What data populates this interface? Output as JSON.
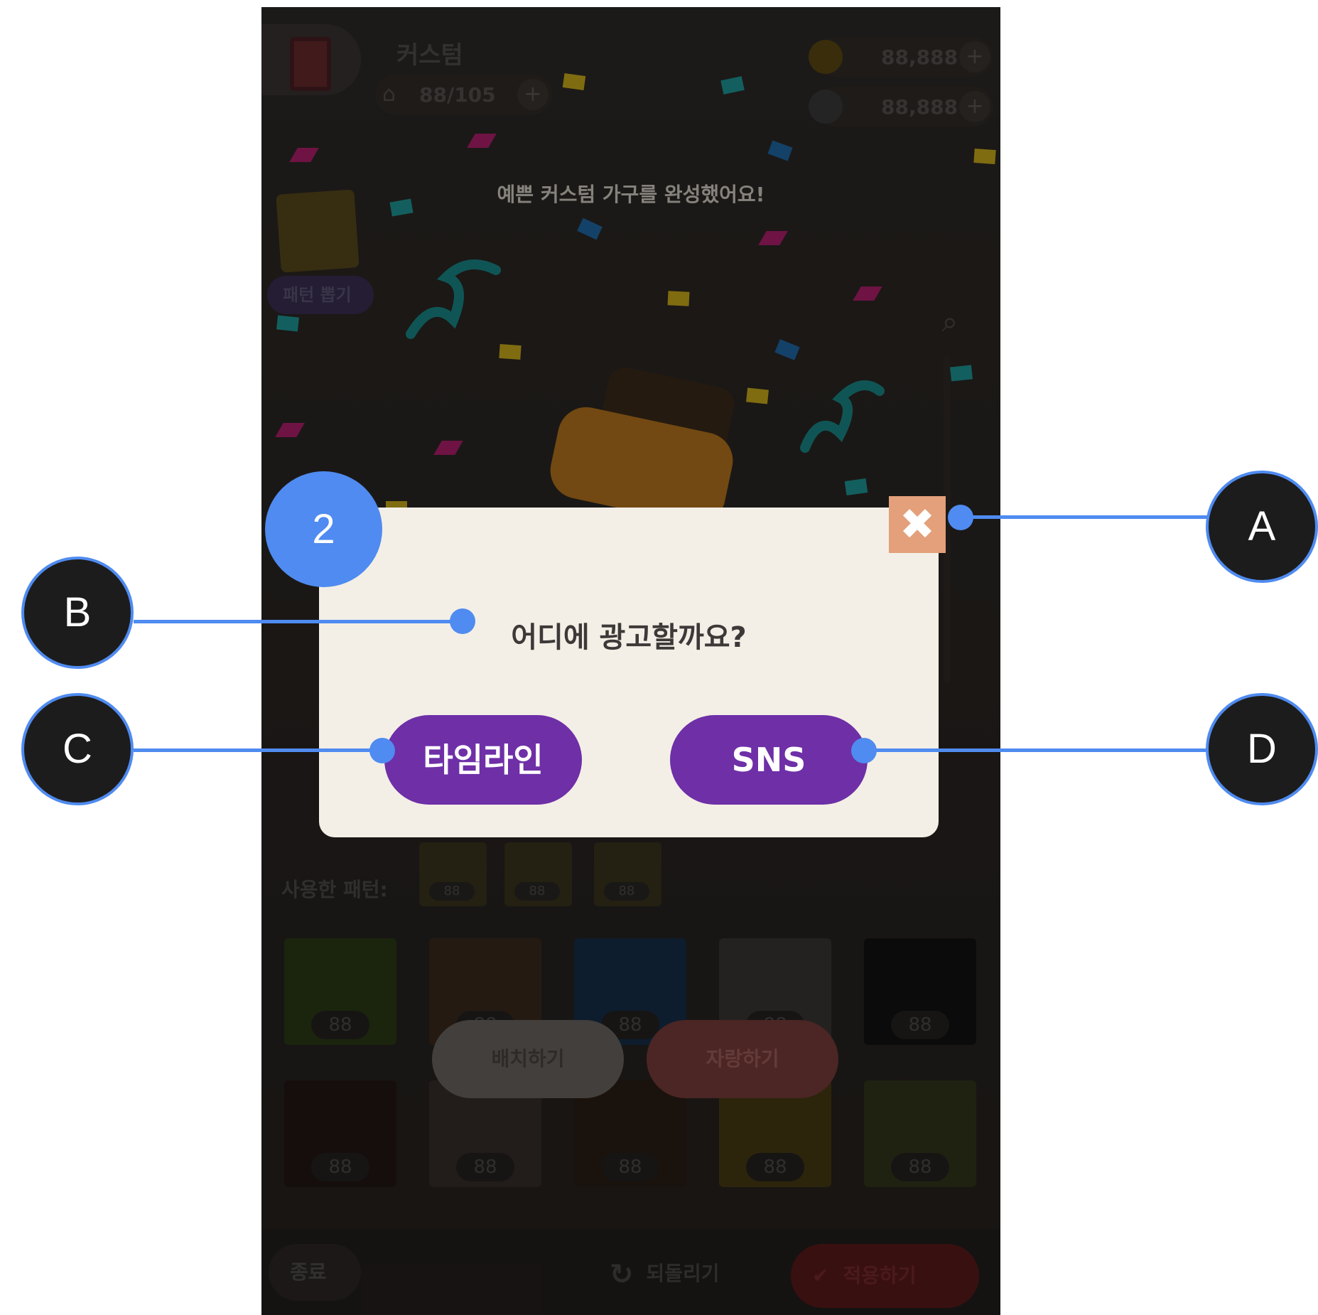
{
  "header": {
    "title": "커스텀",
    "capacity": "88/105",
    "coins": "88,888",
    "gems": "88,888"
  },
  "celebration_text": "예쁜 커스텀 가구를 완성했어요!",
  "pattern_draw_label": "패턴 뽑기",
  "used_patterns": {
    "label": "사용한 패턴:",
    "counts": [
      "88",
      "88",
      "88"
    ]
  },
  "pattern_grid": {
    "counts": [
      "88",
      "88",
      "88",
      "88",
      "88",
      "88",
      "88",
      "88",
      "88",
      "88"
    ]
  },
  "actions": {
    "place_label": "배치하기",
    "show_off_label": "자랑하기"
  },
  "bottom_bar": {
    "quit_label": "종료",
    "undo_label": "되돌리기",
    "apply_label": "적용하기"
  },
  "dialog": {
    "title": "어디에 광고할까요?",
    "timeline_label": "타임라인",
    "sns_label": "SNS",
    "close_icon": "✖"
  },
  "annotations": {
    "step": "2",
    "a": "A",
    "b": "B",
    "c": "C",
    "d": "D",
    "accent_color": "#4f8bf0"
  },
  "colors": {
    "dialog_button": "#6e2fa7",
    "close_button": "#e3a07a",
    "dialog_bg": "#f3efe6"
  }
}
